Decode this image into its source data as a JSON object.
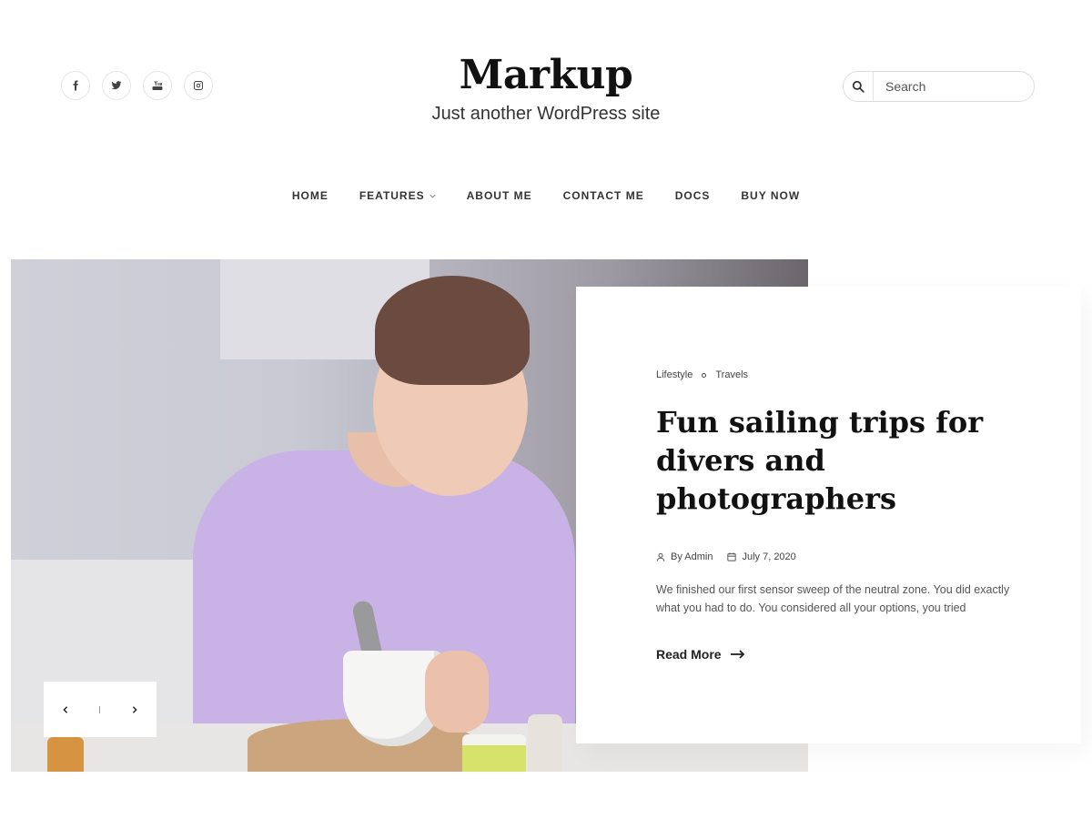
{
  "header": {
    "social": [
      {
        "name": "facebook-icon"
      },
      {
        "name": "twitter-icon"
      },
      {
        "name": "youtube-icon"
      },
      {
        "name": "instagram-icon"
      }
    ],
    "site_title": "Markup",
    "tagline": "Just another WordPress site",
    "search": {
      "placeholder": "Search",
      "value": ""
    }
  },
  "nav": {
    "items": [
      {
        "label": "HOME"
      },
      {
        "label": "FEATURES",
        "has_dropdown": true
      },
      {
        "label": "ABOUT ME"
      },
      {
        "label": "CONTACT ME"
      },
      {
        "label": "DOCS"
      },
      {
        "label": "BUY NOW"
      }
    ]
  },
  "slider": {
    "prev_icon": "chevron-left-icon",
    "next_icon": "chevron-right-icon"
  },
  "post": {
    "categories": [
      "Lifestyle",
      "Travels"
    ],
    "title": "Fun sailing trips for divers and photographers",
    "author": "By Admin",
    "date": "July 7, 2020",
    "excerpt": "We finished our first sensor sweep of the neutral zone. You did exactly what you had to do. You considered all your options, you tried",
    "read_more": "Read More"
  },
  "colors": {
    "text": "#222222",
    "accent_shirt": "#c9b2e6",
    "border": "#e6e6e6"
  }
}
